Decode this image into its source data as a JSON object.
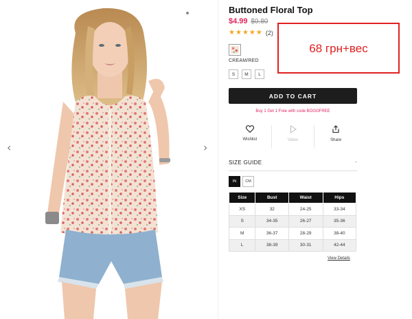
{
  "product": {
    "title": "Buttoned Floral Top",
    "price_sale": "$4.99",
    "price_original": "$0.80",
    "rating_stars": 5,
    "rating_max": 5,
    "review_count": "(2)",
    "color_label": "CREAM/RED",
    "sizes": [
      "S",
      "M",
      "L"
    ]
  },
  "cart": {
    "add_label": "ADD TO CART",
    "promo": "Buy 1 Get 1 Free with code BOGOFREE"
  },
  "actions": {
    "wishlist": {
      "label": "Wishlist",
      "icon": "heart-icon"
    },
    "video": {
      "label": "Video",
      "icon": "play-icon"
    },
    "share": {
      "label": "Share",
      "icon": "share-icon"
    }
  },
  "size_guide": {
    "title": "SIZE GUIDE",
    "toggle": "-",
    "units": [
      "IN",
      "CM"
    ],
    "active_unit": "IN",
    "headers": [
      "Size",
      "Bust",
      "Waist",
      "Hips"
    ],
    "rows": [
      [
        "XS",
        "32",
        "24-25",
        "33-34"
      ],
      [
        "S",
        "34-35",
        "26-27",
        "35-36"
      ],
      [
        "M",
        "36-37",
        "28-29",
        "38-40"
      ],
      [
        "L",
        "38-39",
        "30-31",
        "42-44"
      ]
    ],
    "view_details": "View Details"
  },
  "gallery": {
    "prev_icon": "chevron-left-icon",
    "next_icon": "chevron-right-icon",
    "prev_glyph": "‹",
    "next_glyph": "›"
  },
  "annotation": {
    "text": "68 грн+вес",
    "color": "#e02020"
  },
  "colors": {
    "accent_pink": "#e0245e",
    "star": "#f5a623",
    "button_dark": "#1d1d1d"
  }
}
